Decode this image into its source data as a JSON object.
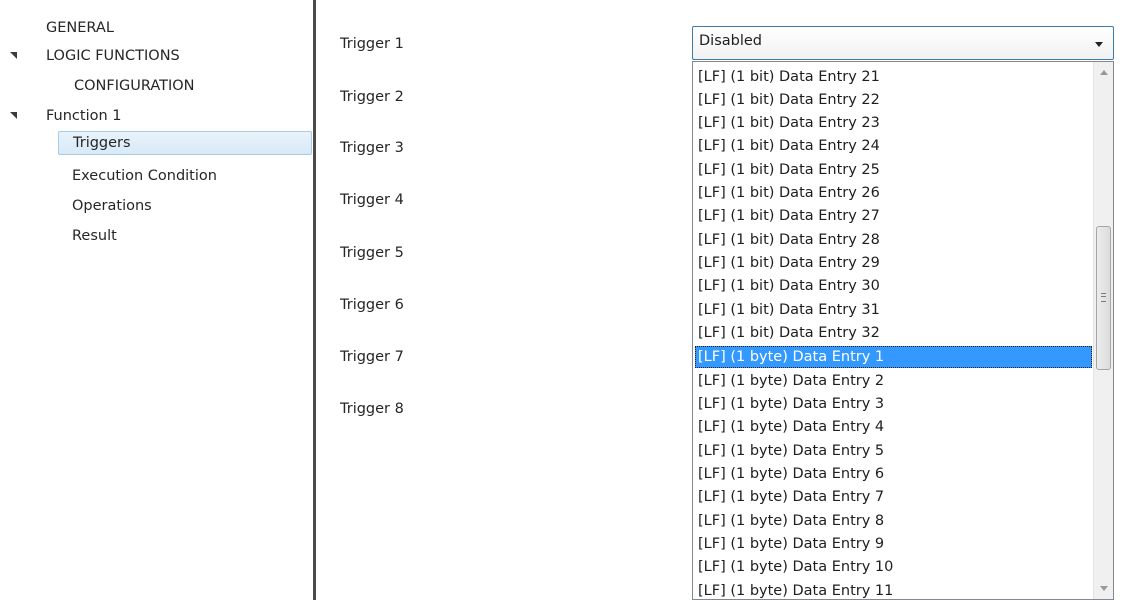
{
  "sidebar": {
    "items": [
      {
        "label": "GENERAL"
      },
      {
        "label": "LOGIC FUNCTIONS"
      },
      {
        "label": "CONFIGURATION"
      },
      {
        "label": "Function 1"
      },
      {
        "label": "Triggers"
      },
      {
        "label": "Execution Condition"
      },
      {
        "label": "Operations"
      },
      {
        "label": "Result"
      }
    ]
  },
  "main": {
    "triggers": [
      "Trigger 1",
      "Trigger 2",
      "Trigger 3",
      "Trigger 4",
      "Trigger 5",
      "Trigger 6",
      "Trigger 7",
      "Trigger 8"
    ],
    "select_value": "Disabled",
    "dropdown_options": [
      "[LF] (1 bit) Data Entry 21",
      "[LF] (1 bit) Data Entry 22",
      "[LF] (1 bit) Data Entry 23",
      "[LF] (1 bit) Data Entry 24",
      "[LF] (1 bit) Data Entry 25",
      "[LF] (1 bit) Data Entry 26",
      "[LF] (1 bit) Data Entry 27",
      "[LF] (1 bit) Data Entry 28",
      "[LF] (1 bit) Data Entry 29",
      "[LF] (1 bit) Data Entry 30",
      "[LF] (1 bit) Data Entry 31",
      "[LF] (1 bit) Data Entry 32",
      "[LF] (1 byte) Data Entry 1",
      "[LF] (1 byte) Data Entry 2",
      "[LF] (1 byte) Data Entry 3",
      "[LF] (1 byte) Data Entry 4",
      "[LF] (1 byte) Data Entry 5",
      "[LF] (1 byte) Data Entry 6",
      "[LF] (1 byte) Data Entry 7",
      "[LF] (1 byte) Data Entry 8",
      "[LF] (1 byte) Data Entry 9",
      "[LF] (1 byte) Data Entry 10",
      "[LF] (1 byte) Data Entry 11"
    ],
    "highlighted_option": "[LF] (1 byte) Data Entry 1"
  },
  "colors": {
    "selection_blue": "#3399ff",
    "tree_selected_bg": "#d7e9f7",
    "panel_divider": "#4a4a4a"
  }
}
